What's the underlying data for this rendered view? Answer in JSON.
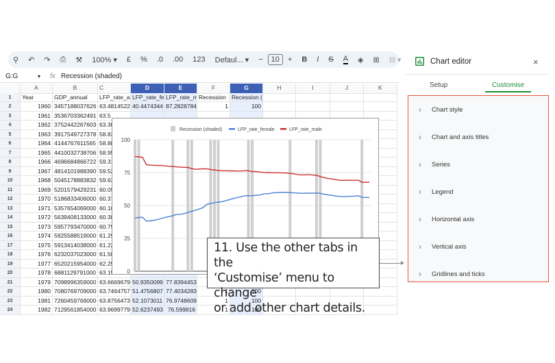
{
  "toolbar": {
    "zoom": "100%",
    "currency": "£",
    "percent": "%",
    "dec_less": ".0",
    "dec_more": ".00",
    "format123": "123",
    "font": "Defaul...",
    "font_size": "10",
    "minus": "−",
    "plus": "+",
    "bold": "B",
    "italic": "I",
    "strike": "S",
    "textcolor": "A"
  },
  "formula_bar": {
    "cell_ref": "G:G",
    "fx": "fx",
    "value": "Recession (shaded)"
  },
  "columns": [
    "A",
    "B",
    "C",
    "D",
    "E",
    "F",
    "G",
    "H",
    "I",
    "J",
    "K"
  ],
  "header_row": [
    "Year",
    "GDP_annual",
    "LFP_rate_all",
    "LFP_rate_fem",
    "LFP_rate_ma",
    "Recession",
    "Recession (shaded)"
  ],
  "rows": [
    [
      "1960",
      "3457188037626",
      "63.4814522",
      "40.4474344",
      "87.2828784",
      "1",
      "100"
    ],
    [
      "1961",
      "3536703362491",
      "63.5",
      "",
      "",
      "",
      ""
    ],
    [
      "1962",
      "3752442267603",
      "63.30",
      "",
      "",
      "",
      ""
    ],
    [
      "1963",
      "3917549727378",
      "58.83",
      "",
      "",
      "",
      ""
    ],
    [
      "1964",
      "4144767611565",
      "58.88",
      "",
      "",
      "",
      ""
    ],
    [
      "1965",
      "4410032738706",
      "58.95",
      "",
      "",
      "",
      ""
    ],
    [
      "1966",
      "4696684866722",
      "59.31",
      "",
      "",
      "",
      ""
    ],
    [
      "1967",
      "4814101988390",
      "59.52",
      "",
      "",
      "",
      ""
    ],
    [
      "1968",
      "5045178883832",
      "59.63",
      "",
      "",
      "",
      ""
    ],
    [
      "1969",
      "5201579429231",
      "60.09",
      "",
      "",
      "",
      ""
    ],
    [
      "1970",
      "5186833406000",
      "60.37",
      "",
      "",
      "",
      ""
    ],
    [
      "1971",
      "5357654069000",
      "60.18",
      "",
      "",
      "",
      ""
    ],
    [
      "1972",
      "5639408133000",
      "60.38",
      "",
      "",
      "",
      ""
    ],
    [
      "1973",
      "5957793470000",
      "60.79",
      "",
      "",
      "",
      ""
    ],
    [
      "1974",
      "5925588519000",
      "61.29",
      "",
      "",
      "",
      ""
    ],
    [
      "1975",
      "5913414038000",
      "61.22",
      "",
      "",
      "",
      ""
    ],
    [
      "1976",
      "6232037023000",
      "61.50",
      "",
      "",
      "",
      ""
    ],
    [
      "1977",
      "6520215954000",
      "62.25",
      "",
      "",
      "",
      ""
    ],
    [
      "1978",
      "6881129791000",
      "63.15",
      "",
      "",
      "",
      ""
    ],
    [
      "1979",
      "7098996359000",
      "63.6669679",
      "50.9350099",
      "77.8394453",
      "",
      ""
    ],
    [
      "1980",
      "7080769709000",
      "63.7464757",
      "51.4756807",
      "77.4034283",
      "1",
      "100"
    ],
    [
      "1981",
      "7260459769000",
      "63.8756473",
      "52.1073011",
      "76.9748609",
      "1",
      "100"
    ],
    [
      "1982",
      "7129561854000",
      "63.9699779",
      "52.6237493",
      "76.599816",
      "1",
      "100"
    ]
  ],
  "chart_data": {
    "type": "line",
    "title": "",
    "legend": [
      "Recession (shaded)",
      "LFP_rate_female",
      "LFP_rate_male"
    ],
    "legend_position": "top",
    "ylim": [
      0,
      100
    ],
    "yticks": [
      "0",
      "25",
      "50",
      "75",
      "100"
    ],
    "x_start": 1960,
    "x_end": 2022,
    "recession_years": [
      1960,
      1961,
      1970,
      1974,
      1975,
      1980,
      1981,
      1982,
      1990,
      1991,
      2001,
      2008,
      2009,
      2020
    ],
    "series": [
      {
        "name": "LFP_rate_female",
        "color": "#4a7fd4",
        "values": [
          40.4,
          40.9,
          41.0,
          38.1,
          38.3,
          38.7,
          39.3,
          40.1,
          41.0,
          41.5,
          42.3,
          43.2,
          43.3,
          43.8,
          44.7,
          45.6,
          46.3,
          47.3,
          48.4,
          50.9,
          51.5,
          52.1,
          52.6,
          52.9,
          53.6,
          54.5,
          55.3,
          56.0,
          56.6,
          57.4,
          57.5,
          57.4,
          57.8,
          57.9,
          58.8,
          58.9,
          59.3,
          59.8,
          59.8,
          60.0,
          59.9,
          59.8,
          59.6,
          59.5,
          59.2,
          59.3,
          59.4,
          59.3,
          59.5,
          59.2,
          58.6,
          58.1,
          57.7,
          57.2,
          57.0,
          56.7,
          56.8,
          57.0,
          57.1,
          57.4,
          56.2,
          56.1,
          56.1
        ]
      },
      {
        "name": "LFP_rate_male",
        "color": "#c9302c",
        "values": [
          87.3,
          87.0,
          86.6,
          81.0,
          80.7,
          80.5,
          80.4,
          80.4,
          80.1,
          79.8,
          79.7,
          79.4,
          79.1,
          79.0,
          78.9,
          78.0,
          77.5,
          77.7,
          77.9,
          77.8,
          77.4,
          77.0,
          76.6,
          76.4,
          76.4,
          76.3,
          76.3,
          76.2,
          76.2,
          76.4,
          76.4,
          75.8,
          75.8,
          75.4,
          75.1,
          75.0,
          74.9,
          74.9,
          74.9,
          74.7,
          74.8,
          74.4,
          74.1,
          73.5,
          73.3,
          73.3,
          73.5,
          73.2,
          73.0,
          72.0,
          71.2,
          70.5,
          70.2,
          69.7,
          69.2,
          69.1,
          69.2,
          69.1,
          69.1,
          69.2,
          67.7,
          67.6,
          67.7
        ]
      }
    ]
  },
  "callout": {
    "line1": "11. Use the other tabs in the",
    "line2": "‘Customise’ menu to change",
    "line3": "or add other chart details."
  },
  "panel": {
    "title": "Chart editor",
    "close": "×",
    "tabs": [
      "Setup",
      "Customise"
    ],
    "sections": [
      "Chart style",
      "Chart and axis titles",
      "Series",
      "Legend",
      "Horizontal axis",
      "Vertical axis",
      "Gridlines and ticks"
    ]
  }
}
